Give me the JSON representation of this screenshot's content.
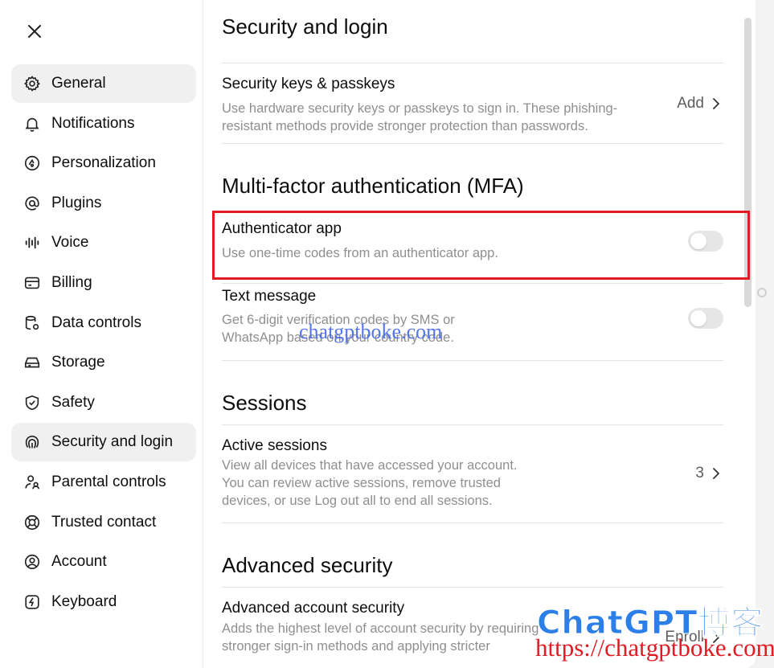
{
  "close_icon": "close-icon",
  "sidebar": {
    "items": [
      {
        "label": "General",
        "icon": "gear-icon",
        "active": true
      },
      {
        "label": "Notifications",
        "icon": "bell-icon",
        "active": false
      },
      {
        "label": "Personalization",
        "icon": "personalization-icon",
        "active": false
      },
      {
        "label": "Plugins",
        "icon": "at-sign-icon",
        "active": false
      },
      {
        "label": "Voice",
        "icon": "waveform-icon",
        "active": false
      },
      {
        "label": "Billing",
        "icon": "card-icon",
        "active": false
      },
      {
        "label": "Data controls",
        "icon": "database-gear-icon",
        "active": false
      },
      {
        "label": "Storage",
        "icon": "storage-drive-icon",
        "active": false
      },
      {
        "label": "Safety",
        "icon": "shield-check-icon",
        "active": false
      },
      {
        "label": "Security and login",
        "icon": "fingerprint-icon",
        "active": true
      },
      {
        "label": "Parental controls",
        "icon": "parent-user-icon",
        "active": false
      },
      {
        "label": "Trusted contact",
        "icon": "lifebuoy-icon",
        "active": false
      },
      {
        "label": "Account",
        "icon": "user-circle-icon",
        "active": false
      },
      {
        "label": "Keyboard",
        "icon": "lightning-icon",
        "active": false
      }
    ]
  },
  "content": {
    "security_title": "Security and login",
    "passkeys": {
      "title": "Security keys & passkeys",
      "desc_line1": "Use hardware security keys or passkeys to sign in. These phishing-",
      "desc_line2": "resistant methods provide stronger protection than passwords.",
      "action": "Add"
    },
    "mfa_title": "Multi-factor authentication (MFA)",
    "authenticator": {
      "title": "Authenticator app",
      "desc": "Use one-time codes from an authenticator app.",
      "enabled": false
    },
    "text_message": {
      "title": "Text message",
      "desc_line1": "Get 6-digit verification codes by SMS or",
      "desc_line2": "WhatsApp based on your country code.",
      "enabled": false
    },
    "sessions_title": "Sessions",
    "active_sessions": {
      "title": "Active sessions",
      "desc_line1": "View all devices that have accessed your account.",
      "desc_line2": "You can review active sessions, remove trusted",
      "desc_line3": "devices, or use Log out all to end all sessions.",
      "count": "3"
    },
    "advanced_title": "Advanced security",
    "advanced_account": {
      "title": "Advanced account security",
      "desc_line1": "Adds the highest level of account security by requiring",
      "desc_line2": "stronger sign-in methods and applying stricter",
      "action": "Enroll"
    }
  },
  "watermarks": {
    "mid": "chatgptboke.com",
    "brand": "ChatGPT博客",
    "url": "https://chatgptboke.com"
  },
  "colors": {
    "highlight": "#e01b24",
    "watermark_blue": "#2c7fe8",
    "watermark_url": "#e01b24",
    "toggle_off": "#e6e6e6"
  }
}
